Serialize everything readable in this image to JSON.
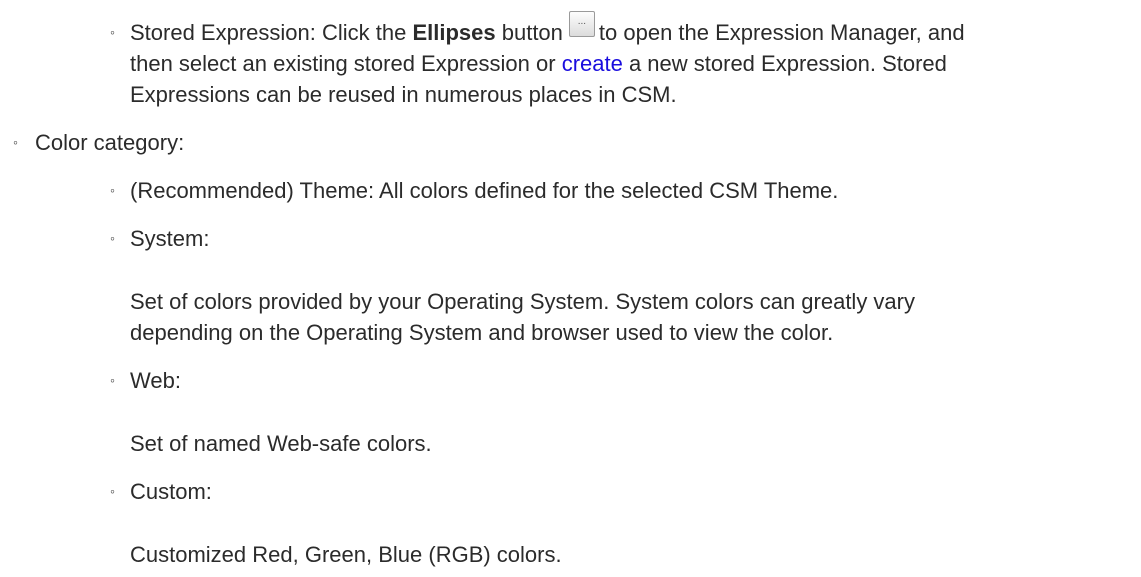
{
  "stored_expression": {
    "label": "Stored Expression: Click the ",
    "button_name": "Ellipses",
    "after_button_word": " button",
    "button_icon_text": "...",
    "after_icon": "to open the Expression Manager, and",
    "line2_before_link": "then select an existing stored Expression or ",
    "link_text": "create",
    "line2_after_link": " a new stored Expression. Stored",
    "line3": "Expressions can be reused in numerous places in CSM."
  },
  "color_category": {
    "label": "Color category:",
    "items": [
      {
        "label": "(Recommended) Theme: All colors defined for the selected CSM Theme."
      },
      {
        "label": "System:",
        "description_lines": [
          "Set of colors provided by your Operating System. System colors can greatly vary",
          "depending on the Operating System and browser used to view the color."
        ]
      },
      {
        "label": "Web:",
        "description_lines": [
          "Set of named Web-safe colors."
        ]
      },
      {
        "label": "Custom:",
        "description_lines": [
          "Customized Red, Green, Blue (RGB) colors."
        ]
      }
    ]
  },
  "bullet_glyph": "◦",
  "colors": {
    "text": "#2b2b2b",
    "link": "#1a0dde"
  }
}
